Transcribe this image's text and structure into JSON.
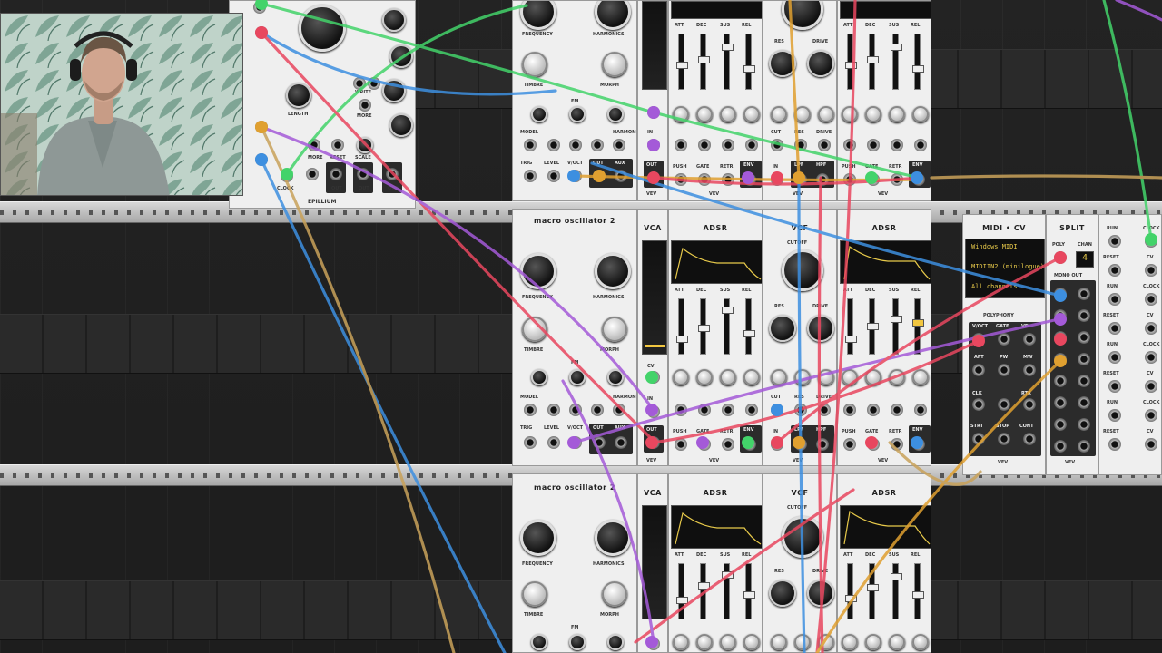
{
  "modules": {
    "sequencer": {
      "length_label": "LENGTH",
      "write_label": "WRITE",
      "more_label": "MORE",
      "reset_label": "RESET",
      "scale_label": "SCALE",
      "clock_label": "CLOCK",
      "out_label": "OUT",
      "brand": "EPILLIUM"
    },
    "macro_oscillator": {
      "title": "macro oscillator 2",
      "frequency": "FREQUENCY",
      "harmonics": "HARMONICS",
      "timbre": "TIMBRE",
      "morph": "MORPH",
      "model": "MODEL",
      "trig": "TRIG",
      "level": "LEVEL",
      "voct": "V/OCT",
      "fm": "FM",
      "out": "OUT",
      "aux": "AUX"
    },
    "vca": {
      "title": "VCA",
      "cv": "CV",
      "in": "IN",
      "out": "OUT",
      "brand": "VEV"
    },
    "adsr": {
      "title": "ADSR",
      "att": "ATT",
      "dec": "DEC",
      "sus": "SUS",
      "rel": "REL",
      "push": "PUSH",
      "gate": "GATE",
      "retr": "RETR",
      "env": "ENV",
      "brand": "VEV"
    },
    "vcf": {
      "title": "VCF",
      "cutoff": "CUTOFF",
      "res": "RES",
      "drive": "DRIVE",
      "cut": "CUT",
      "in": "IN",
      "lpf": "LPF",
      "hpf": "HPF",
      "brand": "VEV"
    },
    "midi_cv": {
      "title": "MIDI • CV",
      "lines": [
        "Windows MIDI",
        "MIDIIN2 (minilogue)",
        "All channels"
      ],
      "polyphony": "POLYPHONY",
      "voct": "V/OCT",
      "gate": "GATE",
      "vel": "VEL",
      "aft": "AFT",
      "pw": "PW",
      "mw": "MW",
      "start": "STRT",
      "stop": "STOP",
      "cont": "CONT",
      "clk": "CLK",
      "retr": "RTR",
      "brand": "VEV"
    },
    "split": {
      "title": "SPLIT",
      "poly": "POLY",
      "chan": "CHAN",
      "chan_value": "4",
      "mono_out": "MONO OUT",
      "brand": "VEV"
    },
    "clock": {
      "run": "RUN",
      "clock": "CLOCK",
      "reset": "RESET",
      "cv": "CV"
    }
  },
  "colors": {
    "red": "#e8475f",
    "blue": "#3d8fe0",
    "purple": "#a45ad8",
    "green": "#43d36a",
    "orange": "#e0a030",
    "tan": "#c9a25a",
    "yellow": "#f2c740"
  }
}
